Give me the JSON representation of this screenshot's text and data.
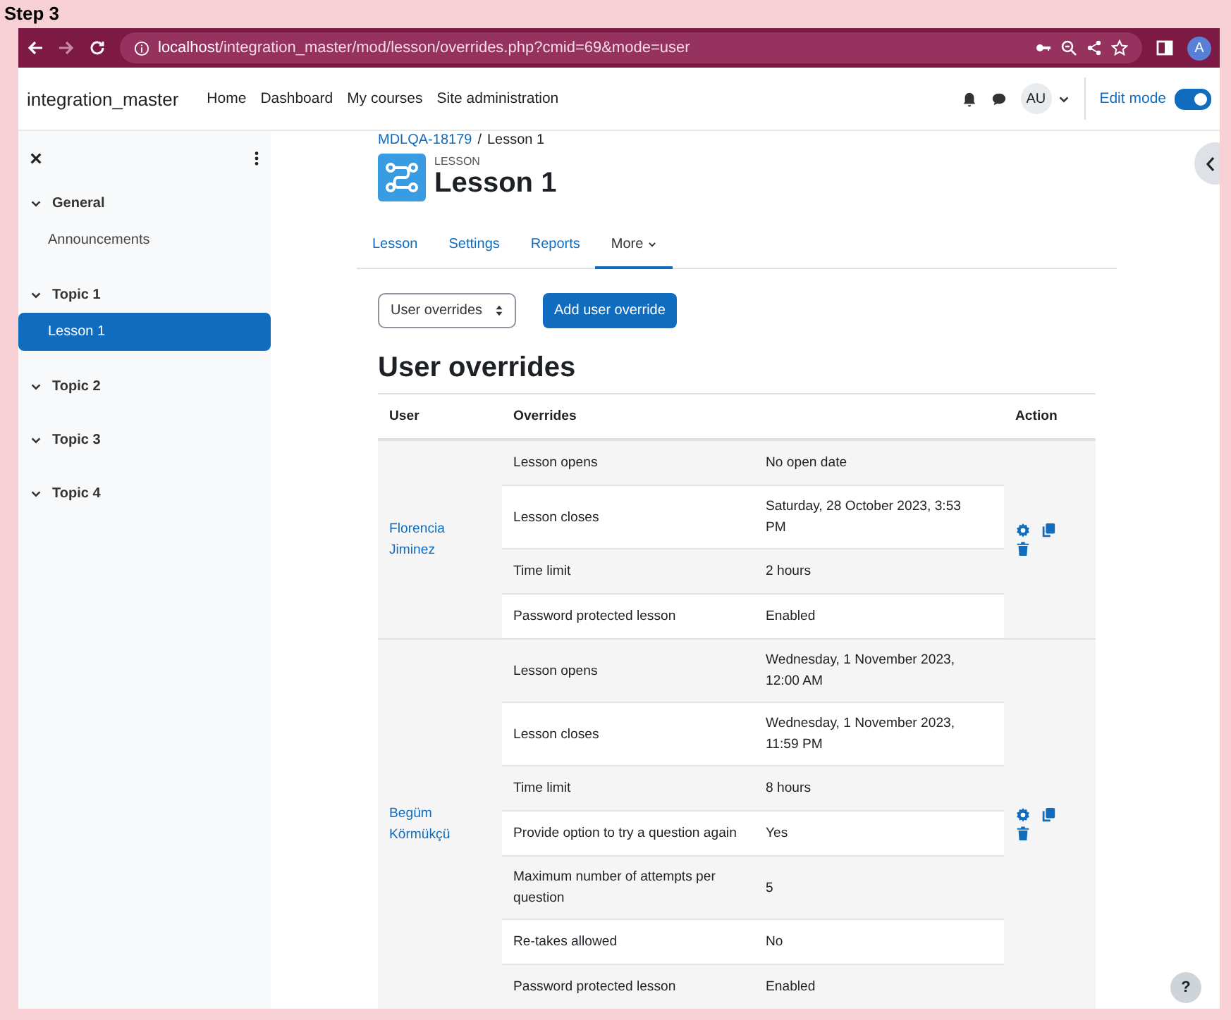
{
  "step_label": "Step 3",
  "browser": {
    "url_host": "localhost",
    "url_path": "/integration_master/mod/lesson/overrides.php?cmid=69&mode=user",
    "profile_initial": "A"
  },
  "navbar": {
    "site_name": "integration_master",
    "links": [
      "Home",
      "Dashboard",
      "My courses",
      "Site administration"
    ],
    "user_initials": "AU",
    "edit_mode": {
      "label": "Edit mode",
      "on": true
    }
  },
  "sidebar": {
    "sections": [
      {
        "title": "General",
        "expanded": true,
        "items": [
          {
            "label": "Announcements",
            "selected": false
          }
        ]
      },
      {
        "title": "Topic 1",
        "expanded": true,
        "items": [
          {
            "label": "Lesson 1",
            "selected": true
          }
        ]
      },
      {
        "title": "Topic 2",
        "expanded": true
      },
      {
        "title": "Topic 3",
        "expanded": true
      },
      {
        "title": "Topic 4",
        "expanded": true
      }
    ]
  },
  "breadcrumb": [
    "MDLQA-18179",
    "Lesson 1"
  ],
  "breadcrumb_separator": "/",
  "activity": {
    "type_label": "LESSON",
    "title": "Lesson 1"
  },
  "tabs": [
    {
      "label": "Lesson",
      "selected": false,
      "kind": "link"
    },
    {
      "label": "Settings",
      "selected": false,
      "kind": "link"
    },
    {
      "label": "Reports",
      "selected": false,
      "kind": "link"
    },
    {
      "label": "More",
      "selected": true,
      "kind": "dropdown"
    }
  ],
  "mode_select": {
    "value": "User overrides"
  },
  "add_button": "Add user override",
  "heading": "User overrides",
  "table": {
    "columns": [
      "User",
      "Overrides",
      "Action"
    ],
    "rows": [
      {
        "user": "Florencia Jiminez",
        "overrides": [
          {
            "setting": "Lesson opens",
            "value": "No open date"
          },
          {
            "setting": "Lesson closes",
            "value": "Saturday, 28 October 2023, 3:53 PM"
          },
          {
            "setting": "Time limit",
            "value": "2 hours"
          },
          {
            "setting": "Password protected lesson",
            "value": "Enabled"
          }
        ]
      },
      {
        "user": "Begüm Körmükçü",
        "overrides": [
          {
            "setting": "Lesson opens",
            "value": "Wednesday, 1 November 2023, 12:00 AM"
          },
          {
            "setting": "Lesson closes",
            "value": "Wednesday, 1 November 2023, 11:59 PM"
          },
          {
            "setting": "Time limit",
            "value": "8 hours"
          },
          {
            "setting": "Provide option to try a question again",
            "value": "Yes"
          },
          {
            "setting": "Maximum number of attempts per question",
            "value": "5"
          },
          {
            "setting": "Re-takes allowed",
            "value": "No"
          },
          {
            "setting": "Password protected lesson",
            "value": "Enabled"
          }
        ]
      }
    ]
  },
  "help_button": "?"
}
